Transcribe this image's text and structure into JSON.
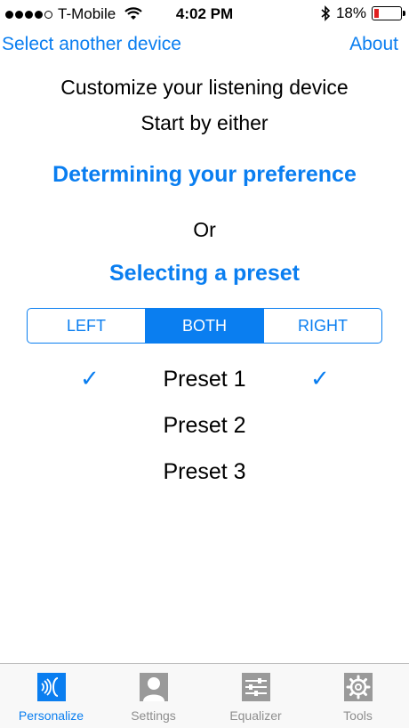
{
  "status_bar": {
    "carrier": "T-Mobile",
    "time": "4:02 PM",
    "battery_percent": "18%",
    "battery_level": 0.18,
    "signal_bars": 4,
    "signal_total": 5
  },
  "nav": {
    "left_link": "Select another device",
    "right_link": "About"
  },
  "main": {
    "heading": "Customize your listening device",
    "subheading": "Start by either",
    "option1": "Determining your preference",
    "or_text": "Or",
    "option2": "Selecting a preset"
  },
  "segmented": {
    "options": [
      "LEFT",
      "BOTH",
      "RIGHT"
    ],
    "selected": "BOTH"
  },
  "presets": [
    {
      "label": "Preset 1",
      "checked_left": true,
      "checked_right": true
    },
    {
      "label": "Preset 2",
      "checked_left": false,
      "checked_right": false
    },
    {
      "label": "Preset 3",
      "checked_left": false,
      "checked_right": false
    }
  ],
  "check_glyph": "✓",
  "tabbar": {
    "tabs": [
      {
        "label": "Personalize",
        "icon": "personalize-icon",
        "active": true
      },
      {
        "label": "Settings",
        "icon": "person-icon",
        "active": false
      },
      {
        "label": "Equalizer",
        "icon": "equalizer-icon",
        "active": false
      },
      {
        "label": "Tools",
        "icon": "gear-icon",
        "active": false
      }
    ]
  },
  "colors": {
    "accent": "#0a7ef0",
    "inactive": "#8e8e8e",
    "battery_low": "#e02020"
  }
}
